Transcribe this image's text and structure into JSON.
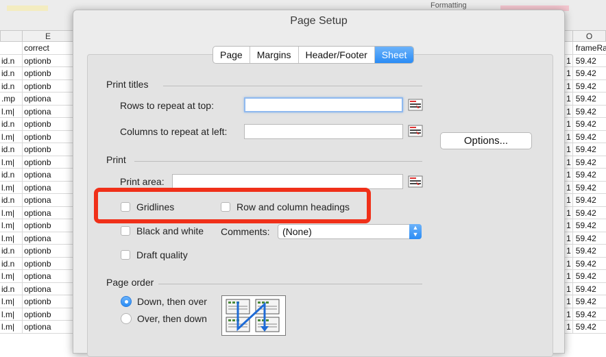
{
  "spreadsheet": {
    "toolbar_text": "Formatting",
    "col_e": "E",
    "col_o": "O",
    "header_e": "correct",
    "header_o": "frameRa",
    "rows": [
      {
        "d": "id.n",
        "e": "optionb",
        "n": "1",
        "o": "59.42"
      },
      {
        "d": "id.n",
        "e": "optionb",
        "n": "1",
        "o": "59.42"
      },
      {
        "d": "id.n",
        "e": "optionb",
        "n": "1",
        "o": "59.42"
      },
      {
        "d": ".mp",
        "e": "optiona",
        "n": "1",
        "o": "59.42"
      },
      {
        "d": "l.m|",
        "e": "optiona",
        "n": "1",
        "o": "59.42"
      },
      {
        "d": "id.n",
        "e": "optionb",
        "n": "1",
        "o": "59.42"
      },
      {
        "d": "l.m|",
        "e": "optionb",
        "n": "1",
        "o": "59.42"
      },
      {
        "d": "id.n",
        "e": "optionb",
        "n": "1",
        "o": "59.42"
      },
      {
        "d": "l.m|",
        "e": "optionb",
        "n": "1",
        "o": "59.42"
      },
      {
        "d": "id.n",
        "e": "optiona",
        "n": "1",
        "o": "59.42"
      },
      {
        "d": "l.m|",
        "e": "optiona",
        "n": "1",
        "o": "59.42"
      },
      {
        "d": "id.n",
        "e": "optiona",
        "n": "1",
        "o": "59.42"
      },
      {
        "d": "l.m|",
        "e": "optiona",
        "n": "1",
        "o": "59.42"
      },
      {
        "d": "l.m|",
        "e": "optionb",
        "n": "1",
        "o": "59.42"
      },
      {
        "d": "l.m|",
        "e": "optiona",
        "n": "1",
        "o": "59.42"
      },
      {
        "d": "id.n",
        "e": "optionb",
        "n": "1",
        "o": "59.42"
      },
      {
        "d": "id.n",
        "e": "optionb",
        "n": "1",
        "o": "59.42"
      },
      {
        "d": "l.m|",
        "e": "optiona",
        "n": "1",
        "o": "59.42"
      },
      {
        "d": "id.n",
        "e": "optiona",
        "n": "1",
        "o": "59.42"
      },
      {
        "d": "l.m|",
        "e": "optionb",
        "n": "1",
        "o": "59.42"
      },
      {
        "d": "l.m|",
        "e": "optionb",
        "n": "1",
        "o": "59.42"
      },
      {
        "d": "l.m|",
        "e": "optiona",
        "n": "1",
        "o": "59.42"
      }
    ]
  },
  "dialog": {
    "title": "Page Setup",
    "tabs": [
      "Page",
      "Margins",
      "Header/Footer",
      "Sheet"
    ],
    "active_tab": "Sheet",
    "print_titles": {
      "section": "Print titles",
      "rows_label": "Rows to repeat at top:",
      "rows_value": "",
      "cols_label": "Columns to repeat at left:",
      "cols_value": ""
    },
    "options_button": "Options...",
    "print": {
      "section": "Print",
      "area_label": "Print area:",
      "area_value": "",
      "gridlines": "Gridlines",
      "headings": "Row and column headings",
      "black_white": "Black and white",
      "comments_label": "Comments:",
      "comments_value": "(None)",
      "draft": "Draft quality"
    },
    "page_order": {
      "section": "Page order",
      "down_over": "Down, then over",
      "over_down": "Over, then down",
      "selected": "Down, then over"
    },
    "accent_color": "#2a8cf5",
    "highlight_color": "#f03019"
  }
}
